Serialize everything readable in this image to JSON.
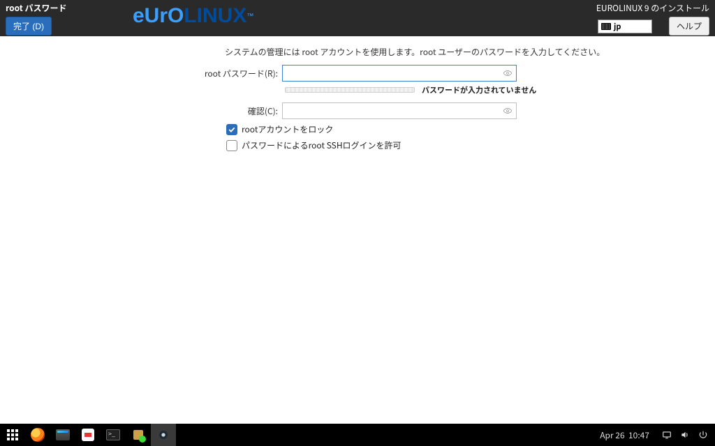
{
  "header": {
    "page_title": "root パスワード",
    "done_label": "完了 (D)",
    "logo": {
      "part1": "eUrO",
      "part2": "LINUX",
      "tm": "™"
    },
    "install_title": "EUROLINUX 9 のインストール",
    "keyboard_layout": "jp",
    "help_label": "ヘルプ"
  },
  "form": {
    "description": "システムの管理には root アカウントを使用します。root ユーザーのパスワードを入力してください。",
    "password_label": "root パスワード(R):",
    "confirm_label": "確認(C):",
    "strength_text": "パスワードが入力されていません",
    "lock_root_label": "rootアカウントをロック",
    "ssh_login_label": "パスワードによるroot SSHログインを許可",
    "lock_root_checked": true,
    "ssh_login_checked": false
  },
  "taskbar": {
    "date": "Apr 26",
    "time": "10:47"
  }
}
